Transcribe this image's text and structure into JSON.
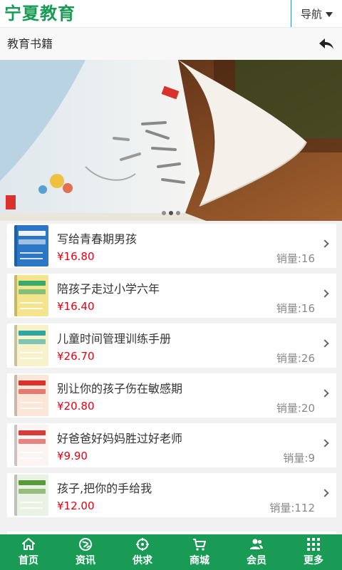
{
  "header": {
    "logo": "宁夏教育",
    "nav_label": "导航"
  },
  "subheader": {
    "title": "教育书籍"
  },
  "banner": {
    "slide_count": 3,
    "active_slide": 1
  },
  "products": [
    {
      "title": "写给青春期男孩",
      "price": "¥16.80",
      "sales": "销量:16",
      "cover": "#2b77c6",
      "accent": "#f0f4f8"
    },
    {
      "title": "陪孩子走过小学六年",
      "price": "¥16.40",
      "sales": "销量:16",
      "cover": "#f3e48d",
      "accent": "#3aa96c"
    },
    {
      "title": "儿童时间管理训练手册",
      "price": "¥26.70",
      "sales": "销量:26",
      "cover": "#f7f2c9",
      "accent": "#2ea5a0"
    },
    {
      "title": "别让你的孩子伤在敏感期",
      "price": "¥20.80",
      "sales": "销量:20",
      "cover": "#fbe6d7",
      "accent": "#d9312b"
    },
    {
      "title": "好爸爸好妈妈胜过好老师",
      "price": "¥9.90",
      "sales": "销量:9",
      "cover": "#fcf3f3",
      "accent": "#d73a3a"
    },
    {
      "title": "孩子,把你的手给我",
      "price": "¥12.00",
      "sales": "销量:112",
      "cover": "#eaf2e4",
      "accent": "#5b9a3a"
    }
  ],
  "tabs": [
    {
      "label": "首页",
      "icon": "home-icon"
    },
    {
      "label": "资讯",
      "icon": "globe-icon"
    },
    {
      "label": "供求",
      "icon": "crosshair-icon"
    },
    {
      "label": "商城",
      "icon": "cart-icon"
    },
    {
      "label": "会员",
      "icon": "users-icon"
    },
    {
      "label": "更多",
      "icon": "grid-icon"
    }
  ],
  "colors": {
    "brand": "#1a9b55",
    "price": "#e60012",
    "sales": "#888888"
  }
}
